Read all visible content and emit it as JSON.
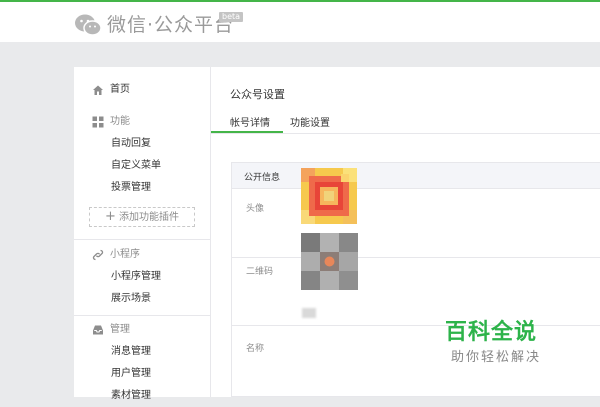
{
  "header": {
    "brand": "微信·公众平台",
    "beta_badge": "beta",
    "logo_icon": "wechat-logo-icon"
  },
  "sidebar": {
    "home": {
      "label": "首页",
      "icon": "home-icon"
    },
    "features": {
      "label": "功能",
      "icon": "grid-icon",
      "items": [
        "自动回复",
        "自定义菜单",
        "投票管理"
      ],
      "add_plugin": "添加功能插件"
    },
    "mini_program": {
      "label": "小程序",
      "icon": "link-icon",
      "items": [
        "小程序管理",
        "展示场景"
      ]
    },
    "management": {
      "label": "管理",
      "icon": "inbox-icon",
      "items": [
        "消息管理",
        "用户管理",
        "素材管理"
      ]
    }
  },
  "main": {
    "title": "公众号设置",
    "tabs": [
      {
        "label": "帐号详情",
        "active": true
      },
      {
        "label": "功能设置",
        "active": false
      }
    ],
    "section": {
      "title": "公开信息",
      "fields": [
        "头像",
        "二维码",
        "名称"
      ]
    }
  },
  "watermark": {
    "title": "百科全说",
    "subtitle": "助你轻松解决"
  },
  "colors": {
    "accent": "#44b549",
    "watermark_green": "#2db34a"
  }
}
